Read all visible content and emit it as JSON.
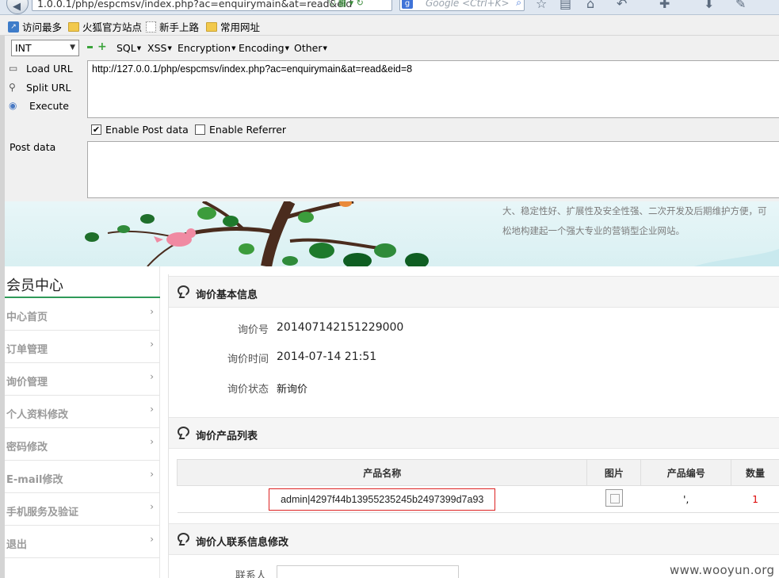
{
  "browser": {
    "url": "1.0.0.1/php/espcmsv/index.php?ac=enquirymain&at=read&eid",
    "search_placeholder": "Google <Ctrl+K>",
    "search_engine_glyph": "g"
  },
  "bookmarks": [
    {
      "label": "访问最多",
      "icon": "visited-icon"
    },
    {
      "label": "火狐官方站点",
      "icon": "folder-icon"
    },
    {
      "label": "新手上路",
      "icon": "page-icon"
    },
    {
      "label": "常用网址",
      "icon": "folder-icon"
    }
  ],
  "hackbar": {
    "select_value": "INT",
    "menus": [
      "SQL",
      "XSS",
      "Encryption",
      "Encoding",
      "Other"
    ],
    "load_url": "Load URL",
    "split_url": "Split URL",
    "execute": "Execute",
    "url_value": "http://127.0.0.1/php/espcmsv/index.php?ac=enquirymain&at=read&eid=8",
    "enable_post": "Enable Post data",
    "enable_post_checked": true,
    "enable_referrer": "Enable Referrer",
    "enable_referrer_checked": false,
    "post_label": "Post data",
    "post_value": ""
  },
  "banner": {
    "line1": "大、稳定性好、扩展性及安全性强、二次开发及后期维护方便，可",
    "line2": "松地构建起一个强大专业的营销型企业网站。"
  },
  "sidebar": {
    "title": "会员中心",
    "items": [
      "中心首页",
      "订单管理",
      "询价管理",
      "个人资料修改",
      "密码修改",
      "E-mail修改",
      "手机服务及验证",
      "退出"
    ]
  },
  "main": {
    "basic_title": "询价基本信息",
    "fields": [
      {
        "label": "询价号",
        "value": "201407142151229000"
      },
      {
        "label": "询价时间",
        "value": "2014-07-14 21:51"
      },
      {
        "label": "询价状态",
        "value": "新询价"
      }
    ],
    "product_title": "询价产品列表",
    "table_headers": [
      "产品名称",
      "图片",
      "产品编号",
      "数量"
    ],
    "rows": [
      {
        "name": "admin|4297f44b13955235245b2497399d7a93",
        "code": "',",
        "qty": "1"
      }
    ],
    "contact_title": "询价人联系信息修改",
    "contact_label": "联系人",
    "contact_value": ""
  },
  "watermark": "www.wooyun.org",
  "colors": {
    "accent_green": "#2f9a59",
    "highlight_red": "#dd2222",
    "qty_red": "#dd0000"
  }
}
